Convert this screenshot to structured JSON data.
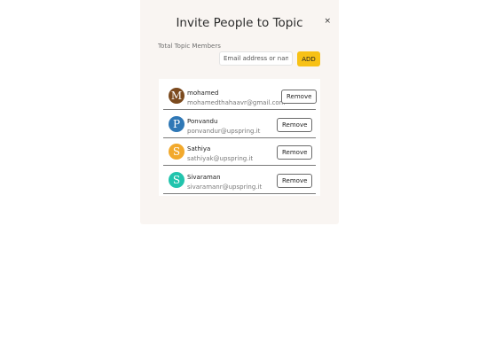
{
  "modal": {
    "title": "Invite People to Topic",
    "close_label": "×",
    "members_label": "Total Topic Members",
    "email_placeholder": "Email address or name",
    "add_label": "ADD"
  },
  "members": [
    {
      "initial": "M",
      "name": "mohamed",
      "email": "mohamedthahaavr@gmail.com",
      "avatar_color": "#7b4a1e",
      "remove_label": "Remove"
    },
    {
      "initial": "P",
      "name": "Ponvandu",
      "email": "ponvandur@upspring.it",
      "avatar_color": "#2f78b6",
      "remove_label": "Remove"
    },
    {
      "initial": "S",
      "name": "Sathiya",
      "email": "sathiyak@upspring.it",
      "avatar_color": "#f2a92c",
      "remove_label": "Remove"
    },
    {
      "initial": "S",
      "name": "Sivaraman",
      "email": "sivaramanr@upspring.it",
      "avatar_color": "#22c4ad",
      "remove_label": "Remove"
    }
  ]
}
